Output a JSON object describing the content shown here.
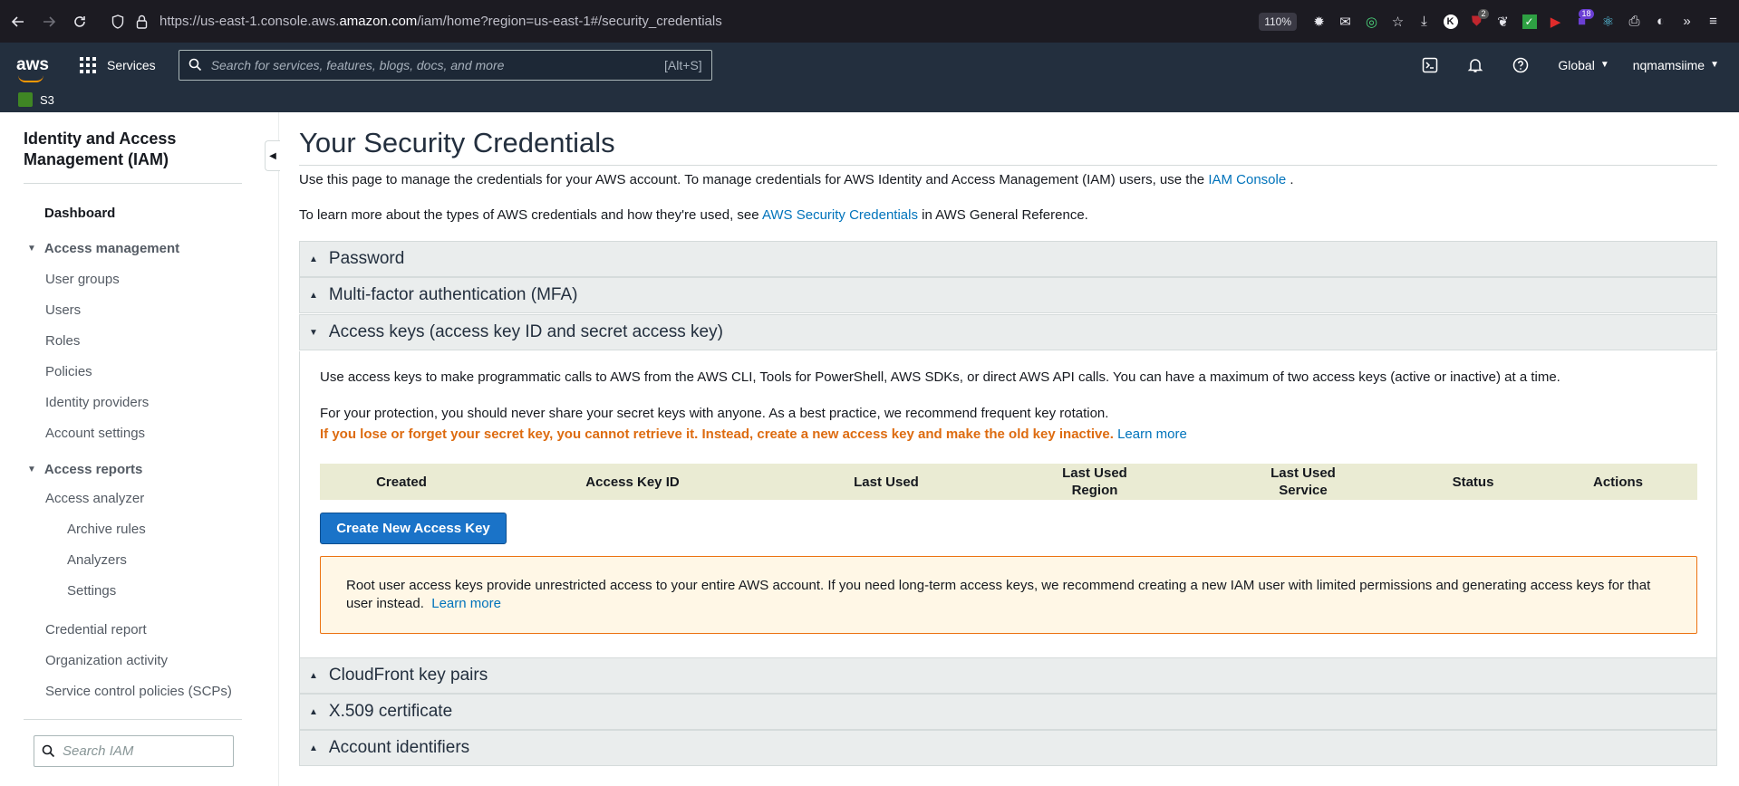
{
  "browser": {
    "url_prefix": "https://us-east-1.console.aws.",
    "url_domain": "amazon.com",
    "url_suffix": "/iam/home?region=us-east-1#/security_credentials",
    "zoom": "110%",
    "badges": {
      "ublock": "2",
      "ext18": "18"
    }
  },
  "header": {
    "logo": "aws",
    "services_label": "Services",
    "search_placeholder": "Search for services, features, blogs, docs, and more",
    "search_shortcut": "[Alt+S]",
    "region": "Global",
    "user": "nqmamsiime"
  },
  "favorites": [
    {
      "label": "S3"
    }
  ],
  "sidebar": {
    "title": "Identity and Access Management (IAM)",
    "dashboard": "Dashboard",
    "access_management": {
      "label": "Access management",
      "items": [
        "User groups",
        "Users",
        "Roles",
        "Policies",
        "Identity providers",
        "Account settings"
      ]
    },
    "access_reports": {
      "label": "Access reports",
      "analyzer": "Access analyzer",
      "analyzer_children": [
        "Archive rules",
        "Analyzers",
        "Settings"
      ],
      "items": [
        "Credential report",
        "Organization activity",
        "Service control policies (SCPs)"
      ]
    },
    "search_placeholder": "Search IAM"
  },
  "main": {
    "title": "Your Security Credentials",
    "intro1_text": "Use this page to manage the credentials for your AWS account. To manage credentials for AWS Identity and Access Management (IAM) users, use the",
    "intro1_link": "IAM Console",
    "intro1_end": ".",
    "intro2_text": "To learn more about the types of AWS credentials and how they're used, see",
    "intro2_link": "AWS Security Credentials",
    "intro2_end": "in AWS General Reference.",
    "sections": {
      "password": "Password",
      "mfa": "Multi-factor authentication (MFA)",
      "access_keys": "Access keys (access key ID and secret access key)",
      "cloudfront": "CloudFront key pairs",
      "x509": "X.509 certificate",
      "account_ids": "Account identifiers"
    },
    "access_keys": {
      "desc": "Use access keys to make programmatic calls to AWS from the AWS CLI, Tools for PowerShell, AWS SDKs, or direct AWS API calls. You can have a maximum of two access keys (active or inactive) at a time.",
      "protection": "For your protection, you should never share your secret keys with anyone. As a best practice, we recommend frequent key rotation.",
      "warning": "If you lose or forget your secret key, you cannot retrieve it. Instead, create a new access key and make the old key inactive.",
      "learn_more": "Learn more",
      "columns": [
        "Created",
        "Access Key ID",
        "Last Used",
        "Last Used Region",
        "Last Used Service",
        "Status",
        "Actions"
      ],
      "create_button": "Create New Access Key",
      "alert_text": "Root user access keys provide unrestricted access to your entire AWS account. If you need long-term access keys, we recommend creating a new IAM user with limited permissions and generating access keys for that user instead.",
      "alert_link": "Learn more"
    }
  }
}
